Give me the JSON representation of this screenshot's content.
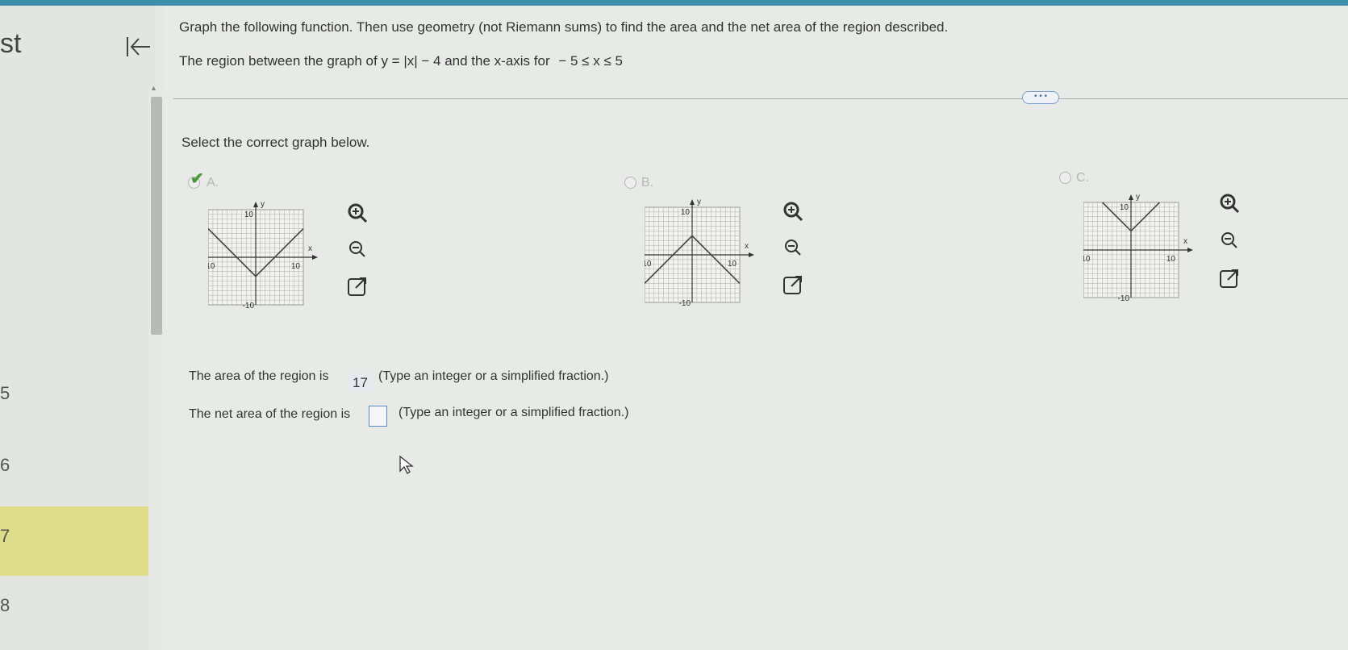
{
  "sidebar": {
    "heading": "st",
    "question_numbers": [
      "5",
      "6",
      "7",
      "8"
    ]
  },
  "question": {
    "instruction": "Graph the following function. Then use geometry (not Riemann sums) to find the area and the net area of the region described.",
    "region_prefix": "The region between the graph of y = |x| − 4 and the x-axis for",
    "region_bounds": "− 5 ≤ x ≤ 5",
    "more_button": "• • •"
  },
  "select_prompt": "Select the correct graph below.",
  "options": [
    {
      "label": "A.",
      "selected": true,
      "shape": "v-down",
      "y_axis": "y",
      "x_axis": "x",
      "y_top": "10",
      "y_bottom": "-10",
      "x_left": "-10",
      "x_right": "10"
    },
    {
      "label": "B.",
      "selected": false,
      "shape": "inverted-v",
      "y_axis": "y",
      "x_axis": "x",
      "y_top": "10",
      "y_bottom": "-10",
      "x_left": "-10",
      "x_right": "10"
    },
    {
      "label": "C.",
      "selected": false,
      "shape": "v-up",
      "y_axis": "y",
      "x_axis": "x",
      "y_top": "10",
      "y_bottom": "-10",
      "x_left": "-10",
      "x_right": "10"
    }
  ],
  "icons": [
    "zoom-in-icon",
    "zoom-out-icon",
    "open-external-icon"
  ],
  "answers": {
    "area_prefix": "The area of the region is",
    "area_value": "17",
    "area_hint": "(Type an integer or a simplified fraction.)",
    "net_prefix": "The net area of the region is",
    "net_value": "",
    "net_hint": "(Type an integer or a simplified fraction.)"
  },
  "colors": {
    "accent": "#3b8fa8",
    "selected_check": "#4a9a3a",
    "highlight_row": "#dedd8a",
    "input_border": "#5a86c6"
  }
}
